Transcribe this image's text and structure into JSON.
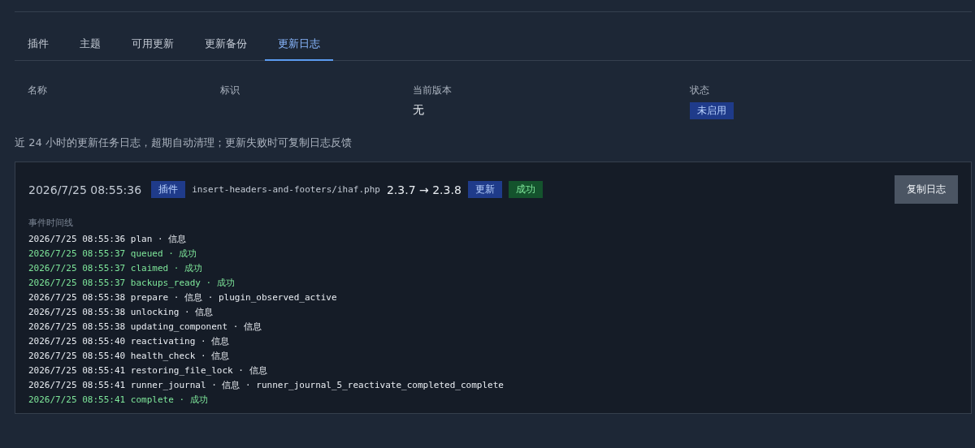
{
  "tabs": [
    {
      "label": "插件",
      "selected": false
    },
    {
      "label": "主题",
      "selected": false
    },
    {
      "label": "可用更新",
      "selected": false
    },
    {
      "label": "更新备份",
      "selected": false
    },
    {
      "label": "更新日志",
      "selected": true
    }
  ],
  "table": {
    "columns": [
      "名称",
      "标识",
      "当前版本",
      "状态"
    ],
    "rows": [
      {
        "name": "",
        "slug": "",
        "version": "无",
        "status": "未启用"
      }
    ]
  },
  "note": "近 24 小时的更新任务日志，超期自动清理；更新失败时可复制日志反馈",
  "log_card": {
    "time": "2026/7/25 08:55:36",
    "type_badge": "插件",
    "file": "insert-headers-and-footers/ihaf.php",
    "versions": "2.3.7 → 2.3.8",
    "action_badge": "更新",
    "result_badge": "成功",
    "copy_button": "复制日志",
    "timeline_title": "事件时间线",
    "events": [
      {
        "kind": "info",
        "text": "2026/7/25 08:55:36 plan · 信息"
      },
      {
        "kind": "success",
        "text": "2026/7/25 08:55:37 queued · 成功"
      },
      {
        "kind": "success",
        "text": "2026/7/25 08:55:37 claimed · 成功"
      },
      {
        "kind": "success",
        "text": "2026/7/25 08:55:37 backups_ready · 成功"
      },
      {
        "kind": "info",
        "text": "2026/7/25 08:55:38 prepare · 信息 · plugin_observed_active"
      },
      {
        "kind": "info",
        "text": "2026/7/25 08:55:38 unlocking · 信息"
      },
      {
        "kind": "info",
        "text": "2026/7/25 08:55:38 updating_component · 信息"
      },
      {
        "kind": "info",
        "text": "2026/7/25 08:55:40 reactivating · 信息"
      },
      {
        "kind": "info",
        "text": "2026/7/25 08:55:40 health_check · 信息"
      },
      {
        "kind": "info",
        "text": "2026/7/25 08:55:41 restoring_file_lock · 信息"
      },
      {
        "kind": "info",
        "text": "2026/7/25 08:55:41 runner_journal · 信息 · runner_journal_5_reactivate_completed_complete"
      },
      {
        "kind": "success",
        "text": "2026/7/25 08:55:41 complete · 成功"
      }
    ]
  }
}
